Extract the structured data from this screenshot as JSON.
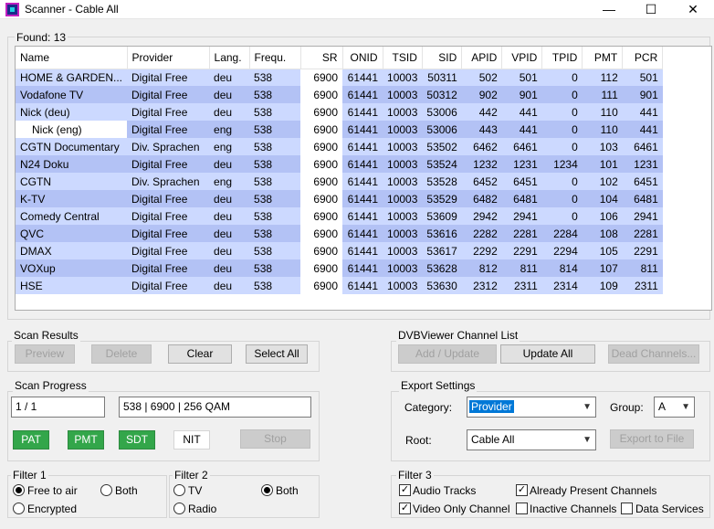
{
  "window": {
    "title": "Scanner - Cable All",
    "min": "—",
    "max": "☐",
    "close": "✕"
  },
  "found": {
    "label": "Found:  13"
  },
  "columns": [
    "Name",
    "Provider",
    "Lang.",
    "Frequ.",
    "SR",
    "ONID",
    "TSID",
    "SID",
    "APID",
    "VPID",
    "TPID",
    "PMT",
    "PCR"
  ],
  "rows": [
    [
      "HOME & GARDEN...",
      "Digital Free",
      "deu",
      "538",
      "6900",
      "61441",
      "10003",
      "50311",
      "502",
      "501",
      "0",
      "112",
      "501"
    ],
    [
      "Vodafone TV",
      "Digital Free",
      "deu",
      "538",
      "6900",
      "61441",
      "10003",
      "50312",
      "902",
      "901",
      "0",
      "111",
      "901"
    ],
    [
      "Nick (deu)",
      "Digital Free",
      "deu",
      "538",
      "6900",
      "61441",
      "10003",
      "53006",
      "442",
      "441",
      "0",
      "110",
      "441"
    ],
    [
      "   Nick (eng)",
      "Digital Free",
      "eng",
      "538",
      "6900",
      "61441",
      "10003",
      "53006",
      "443",
      "441",
      "0",
      "110",
      "441"
    ],
    [
      "CGTN Documentary",
      "Div. Sprachen",
      "eng",
      "538",
      "6900",
      "61441",
      "10003",
      "53502",
      "6462",
      "6461",
      "0",
      "103",
      "6461"
    ],
    [
      "N24 Doku",
      "Digital Free",
      "deu",
      "538",
      "6900",
      "61441",
      "10003",
      "53524",
      "1232",
      "1231",
      "1234",
      "101",
      "1231"
    ],
    [
      "CGTN",
      "Div. Sprachen",
      "eng",
      "538",
      "6900",
      "61441",
      "10003",
      "53528",
      "6452",
      "6451",
      "0",
      "102",
      "6451"
    ],
    [
      "K-TV",
      "Digital Free",
      "deu",
      "538",
      "6900",
      "61441",
      "10003",
      "53529",
      "6482",
      "6481",
      "0",
      "104",
      "6481"
    ],
    [
      "Comedy Central",
      "Digital Free",
      "deu",
      "538",
      "6900",
      "61441",
      "10003",
      "53609",
      "2942",
      "2941",
      "0",
      "106",
      "2941"
    ],
    [
      "QVC",
      "Digital Free",
      "deu",
      "538",
      "6900",
      "61441",
      "10003",
      "53616",
      "2282",
      "2281",
      "2284",
      "108",
      "2281"
    ],
    [
      "DMAX",
      "Digital Free",
      "deu",
      "538",
      "6900",
      "61441",
      "10003",
      "53617",
      "2292",
      "2291",
      "2294",
      "105",
      "2291"
    ],
    [
      "VOXup",
      "Digital Free",
      "deu",
      "538",
      "6900",
      "61441",
      "10003",
      "53628",
      "812",
      "811",
      "814",
      "107",
      "811"
    ],
    [
      "HSE",
      "Digital Free",
      "deu",
      "538",
      "6900",
      "61441",
      "10003",
      "53630",
      "2312",
      "2311",
      "2314",
      "109",
      "2311"
    ]
  ],
  "scan_results": {
    "title": "Scan Results",
    "preview": "Preview",
    "delete": "Delete",
    "clear": "Clear",
    "select_all": "Select All"
  },
  "channel_list": {
    "title": "DVBViewer Channel List",
    "add_update": "Add / Update",
    "update_all": "Update All",
    "dead": "Dead Channels..."
  },
  "scan_progress": {
    "title": "Scan Progress",
    "count": "1 / 1",
    "info": "538 | 6900 | 256 QAM",
    "pat": "PAT",
    "pmt": "PMT",
    "sdt": "SDT",
    "nit": "NIT",
    "stop": "Stop"
  },
  "export": {
    "title": "Export Settings",
    "category_label": "Category:",
    "category_value": "Provider",
    "group_label": "Group:",
    "group_value": "A",
    "root_label": "Root:",
    "root_value": "Cable All",
    "export_btn": "Export to File"
  },
  "filter1": {
    "title": "Filter 1",
    "fta": "Free to air",
    "both": "Both",
    "encrypted": "Encrypted"
  },
  "filter2": {
    "title": "Filter 2",
    "tv": "TV",
    "both": "Both",
    "radio": "Radio"
  },
  "filter3": {
    "title": "Filter 3",
    "audio": "Audio Tracks",
    "already": "Already Present Channels",
    "video_only": "Video Only Channel",
    "inactive": "Inactive Channels",
    "data": "Data Services"
  },
  "colors": {
    "row_light": "#ccd9ff",
    "row_dark": "#b3c2f5",
    "green": "#33a64a",
    "selection": "#0078d7"
  }
}
